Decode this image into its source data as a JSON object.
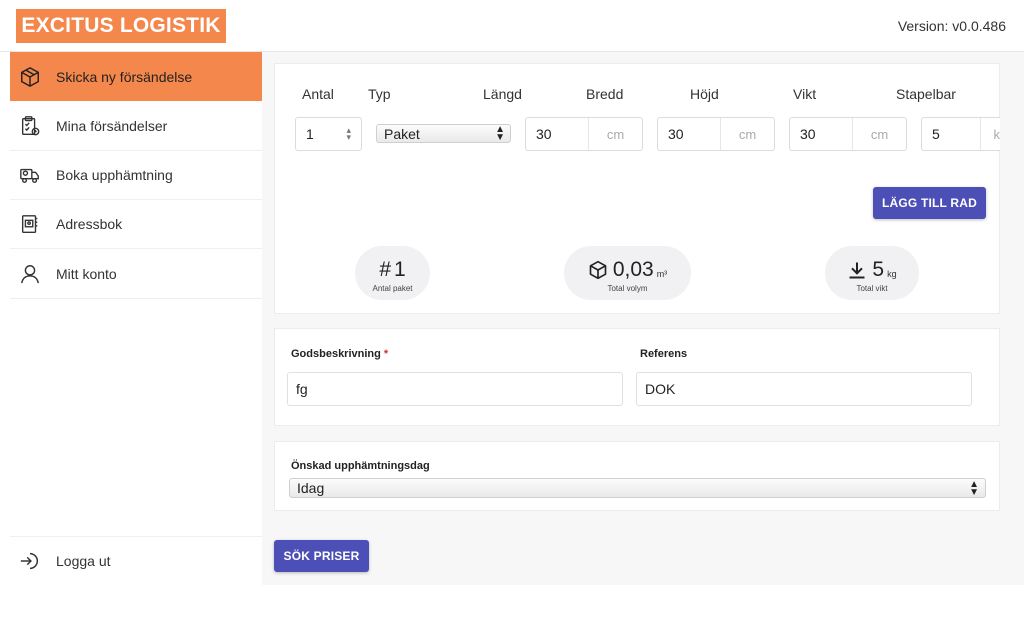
{
  "header": {
    "logo": "EXCITUS LOGISTIK",
    "version": "Version: v0.0.486"
  },
  "sidebar": {
    "items": [
      {
        "label": "Skicka ny försändelse",
        "icon": "box-icon",
        "active": true
      },
      {
        "label": "Mina försändelser",
        "icon": "clipboard-icon",
        "active": false
      },
      {
        "label": "Boka upphämtning",
        "icon": "truck-icon",
        "active": false
      },
      {
        "label": "Adressbok",
        "icon": "addressbook-icon",
        "active": false
      },
      {
        "label": "Mitt konto",
        "icon": "user-icon",
        "active": false
      }
    ],
    "logout": {
      "label": "Logga ut",
      "icon": "logout-icon"
    }
  },
  "package": {
    "columns": {
      "antal": "Antal",
      "typ": "Typ",
      "langd": "Längd",
      "bredd": "Bredd",
      "hojd": "Höjd",
      "vikt": "Vikt",
      "stapelbar": "Stapelbar"
    },
    "row": {
      "antal": "1",
      "typ": "Paket",
      "langd": "30",
      "bredd": "30",
      "hojd": "30",
      "vikt": "5",
      "unit_cm": "cm",
      "unit_kg": "k"
    },
    "add_row_button": "LÄGG TILL RAD",
    "stats": {
      "count_value": "1",
      "count_label": "Antal paket",
      "volume_value": "0,03",
      "volume_unit": "m³",
      "volume_label": "Total volym",
      "weight_value": "5",
      "weight_unit": "kg",
      "weight_label": "Total vikt"
    }
  },
  "description": {
    "goods_label": "Godsbeskrivning",
    "goods_required": "*",
    "goods_value": "fg",
    "reference_label": "Referens",
    "reference_value": "DOK"
  },
  "pickup": {
    "label": "Önskad upphämtningsdag",
    "selected": "Idag"
  },
  "search_button": "SÖK PRISER",
  "colors": {
    "brand": "#f4874b",
    "button": "#4c4fb5",
    "required": "#d32f2f"
  }
}
